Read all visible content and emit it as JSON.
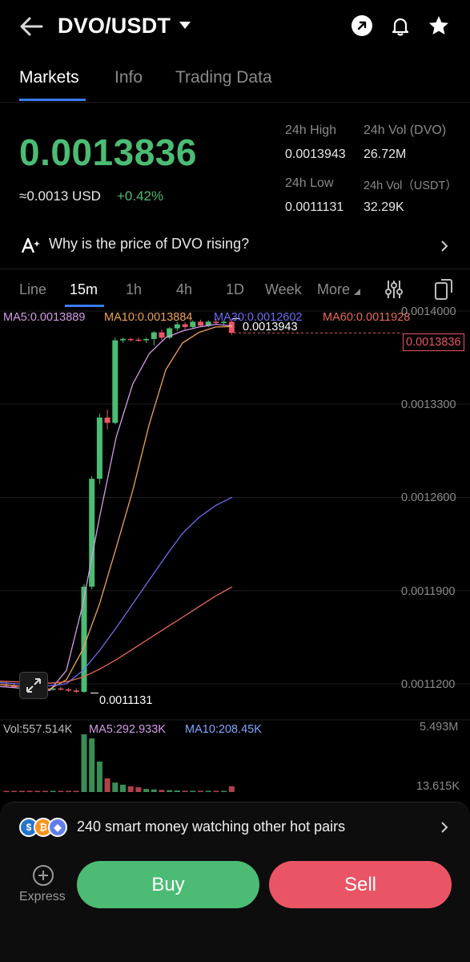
{
  "header": {
    "pair": "DVO/USDT",
    "icons": [
      "back-arrow-icon",
      "chevron-down-icon",
      "share-icon",
      "bell-icon",
      "star-icon"
    ]
  },
  "tabs": [
    {
      "label": "Markets",
      "active": true
    },
    {
      "label": "Info",
      "active": false
    },
    {
      "label": "Trading Data",
      "active": false
    }
  ],
  "ticker": {
    "last_price": "0.0013836",
    "usd_equiv": "≈0.0013 USD",
    "change": "+0.42%",
    "high_label": "24h High",
    "high_value": "0.0013943",
    "low_label": "24h Low",
    "low_value": "0.0011131",
    "vol_base_label": "24h Vol (DVO)",
    "vol_base_value": "26.72M",
    "vol_quote_label": "24h Vol（USDT）",
    "vol_quote_value": "32.29K",
    "colors": {
      "up": "#4cbc75",
      "down": "#ea5565"
    }
  },
  "why": {
    "text": "Why is the price of DVO rising?",
    "icon": "ai-sparkle-icon"
  },
  "timeframes": {
    "items": [
      "Line",
      "15m",
      "1h",
      "4h",
      "1D",
      "Week",
      "More"
    ],
    "active": "15m"
  },
  "chart_data": {
    "type": "candlestick",
    "interval": "15m",
    "ma_legend": [
      {
        "label": "MA5:0.0013889",
        "color": "#d59ce8"
      },
      {
        "label": "MA10:0.0013884",
        "color": "#f0a15a"
      },
      {
        "label": "MA30:0.0012602",
        "color": "#6d6cf2"
      },
      {
        "label": "MA60:0.0011928",
        "color": "#e86a5a"
      }
    ],
    "y_ticks": [
      "0.0014000",
      "0.0013300",
      "0.0012600",
      "0.0011900",
      "0.0011200"
    ],
    "ylim": [
      0.00111,
      0.0014
    ],
    "current_price": "0.0013836",
    "high_marker": "0.0013943",
    "low_marker": "0.0011131",
    "candles": [
      {
        "o": 0.0011195,
        "h": 0.0011215,
        "l": 0.0011175,
        "c": 0.0011185
      },
      {
        "o": 0.0011185,
        "h": 0.0011205,
        "l": 0.001117,
        "c": 0.0011175
      },
      {
        "o": 0.0011175,
        "h": 0.0011195,
        "l": 0.0011165,
        "c": 0.001117
      },
      {
        "o": 0.001117,
        "h": 0.001119,
        "l": 0.001116,
        "c": 0.0011165
      },
      {
        "o": 0.0011165,
        "h": 0.0011185,
        "l": 0.0011155,
        "c": 0.001116
      },
      {
        "o": 0.001116,
        "h": 0.001118,
        "l": 0.001115,
        "c": 0.0011155
      },
      {
        "o": 0.0011155,
        "h": 0.0011175,
        "l": 0.001115,
        "c": 0.0011165
      },
      {
        "o": 0.0011165,
        "h": 0.001118,
        "l": 0.001115,
        "c": 0.0011158
      },
      {
        "o": 0.0011158,
        "h": 0.001117,
        "l": 0.001114,
        "c": 0.001115
      },
      {
        "o": 0.001115,
        "h": 0.0011165,
        "l": 0.0011131,
        "c": 0.001114
      },
      {
        "o": 0.001114,
        "h": 0.001195,
        "l": 0.0011131,
        "c": 0.001193
      },
      {
        "o": 0.001193,
        "h": 0.001276,
        "l": 0.001191,
        "c": 0.001274
      },
      {
        "o": 0.001274,
        "h": 0.001323,
        "l": 0.00127,
        "c": 0.00132
      },
      {
        "o": 0.00132,
        "h": 0.001326,
        "l": 0.001311,
        "c": 0.001316
      },
      {
        "o": 0.001316,
        "h": 0.00138,
        "l": 0.001315,
        "c": 0.001378
      },
      {
        "o": 0.001378,
        "h": 0.00138,
        "l": 0.001376,
        "c": 0.001379
      },
      {
        "o": 0.001379,
        "h": 0.00138,
        "l": 0.001377,
        "c": 0.0013785
      },
      {
        "o": 0.0013785,
        "h": 0.00138,
        "l": 0.001377,
        "c": 0.001378
      },
      {
        "o": 0.001378,
        "h": 0.00138,
        "l": 0.001376,
        "c": 0.001379
      },
      {
        "o": 0.001379,
        "h": 0.001385,
        "l": 0.001374,
        "c": 0.001384
      },
      {
        "o": 0.001384,
        "h": 0.001386,
        "l": 0.001378,
        "c": 0.00138
      },
      {
        "o": 0.00138,
        "h": 0.001388,
        "l": 0.001379,
        "c": 0.001387
      },
      {
        "o": 0.001387,
        "h": 0.001392,
        "l": 0.001385,
        "c": 0.00139
      },
      {
        "o": 0.00139,
        "h": 0.0013915,
        "l": 0.001386,
        "c": 0.001388
      },
      {
        "o": 0.001388,
        "h": 0.001393,
        "l": 0.001387,
        "c": 0.001392
      },
      {
        "o": 0.001392,
        "h": 0.0013935,
        "l": 0.001388,
        "c": 0.001389
      },
      {
        "o": 0.001389,
        "h": 0.001393,
        "l": 0.001388,
        "c": 0.001392
      },
      {
        "o": 0.001392,
        "h": 0.0013943,
        "l": 0.00139,
        "c": 0.001391
      },
      {
        "o": 0.001391,
        "h": 0.001393,
        "l": 0.001389,
        "c": 0.001392
      },
      {
        "o": 0.001392,
        "h": 0.001394,
        "l": 0.001382,
        "c": 0.0013836
      }
    ],
    "ma_lines": {
      "ma5": [
        0.001118,
        0.001117,
        0.001116,
        0.001115,
        0.00113,
        0.00118,
        0.001245,
        0.001305,
        0.001345,
        0.001368,
        0.00138,
        0.001385,
        0.001388,
        0.00139,
        0.0013889
      ],
      "ma10": [
        0.0011195,
        0.0011185,
        0.001117,
        0.001116,
        0.001123,
        0.001146,
        0.00118,
        0.001222,
        0.001265,
        0.001315,
        0.001356,
        0.001376,
        0.001384,
        0.001388,
        0.0013884
      ],
      "ma30": [
        0.001121,
        0.00112,
        0.001119,
        0.0011185,
        0.00112,
        0.00113,
        0.001145,
        0.001162,
        0.00118,
        0.001198,
        0.001216,
        0.001233,
        0.001245,
        0.001254,
        0.0012602
      ],
      "ma60": [
        0.001122,
        0.0011215,
        0.001121,
        0.0011205,
        0.0011215,
        0.001125,
        0.001131,
        0.001138,
        0.001146,
        0.001154,
        0.001162,
        0.00117,
        0.001178,
        0.001186,
        0.0011928
      ]
    },
    "volume": {
      "vol_label": "Vol:557.514K",
      "ma5_label": "MA5:292.933K",
      "ma10_label": "MA10:208.45K",
      "y_ticks": [
        "5.493M",
        "13.615K"
      ],
      "bars": [
        0.012,
        0.01,
        0.009,
        0.011,
        0.008,
        0.01,
        0.009,
        0.011,
        0.012,
        0.02,
        5.493,
        5.1,
        2.9,
        1.3,
        0.9,
        0.7,
        0.55,
        0.45,
        0.3,
        0.25,
        0.2,
        0.18,
        0.15,
        0.12,
        0.1,
        0.09,
        0.08,
        0.07,
        0.06,
        0.557
      ]
    }
  },
  "banner": {
    "text": "240 smart money watching other hot pairs",
    "coins": [
      "usdc",
      "btc",
      "eth"
    ]
  },
  "footer": {
    "express_label": "Express",
    "buy_label": "Buy",
    "sell_label": "Sell"
  }
}
